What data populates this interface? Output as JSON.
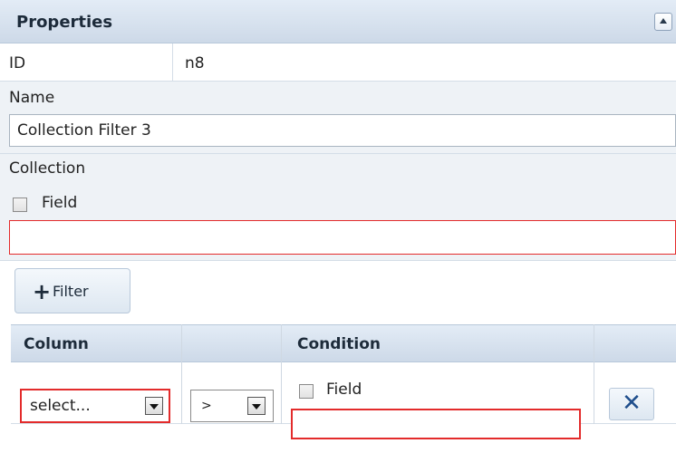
{
  "header": {
    "title": "Properties"
  },
  "id_row": {
    "label": "ID",
    "value": "n8"
  },
  "name": {
    "label": "Name",
    "value": "Collection Filter 3"
  },
  "collection": {
    "label": "Collection",
    "field_label": "Field",
    "value": ""
  },
  "add_filter": {
    "label": "Filter",
    "icon": "plus-icon"
  },
  "table": {
    "headers": [
      "Column",
      "",
      "Condition",
      ""
    ],
    "rows": [
      {
        "column_select": "select...",
        "operator": ">",
        "condition_field_label": "Field",
        "condition_value": ""
      }
    ]
  },
  "colors": {
    "error_border": "#e32b2b",
    "header_bg": "#d6e1ee",
    "delete_icon": "#1f4e8c"
  }
}
